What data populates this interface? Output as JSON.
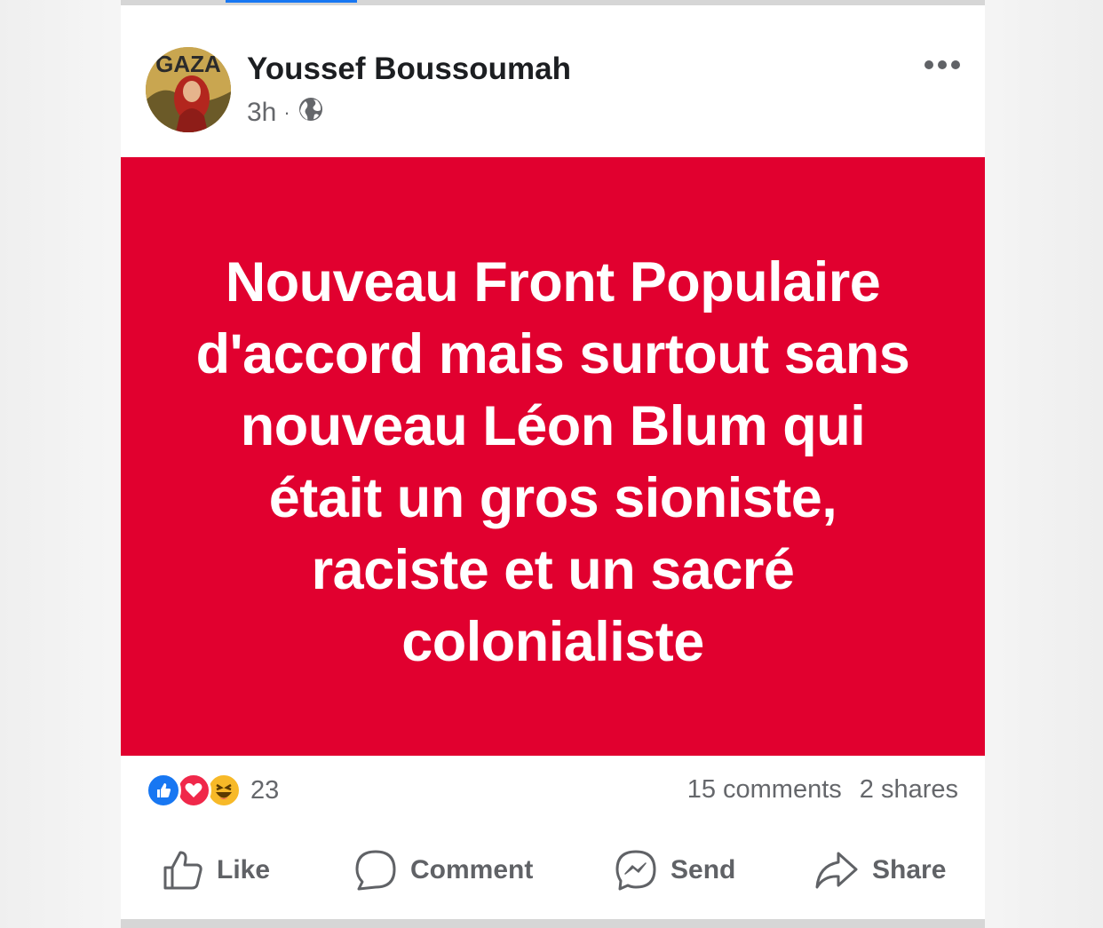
{
  "post": {
    "author": "Youssef Boussoumah",
    "time": "3h",
    "avatar_text": "GAZA",
    "text": "Nouveau Front Populaire\nd'accord mais surtout sans\nnouveau Léon Blum qui\nétait un gros sioniste,\nraciste et un sacré\ncolonialiste",
    "background_color": "#e1002f"
  },
  "stats": {
    "reaction_count": "23",
    "reactions": [
      "like-icon",
      "love-icon",
      "haha-icon"
    ],
    "comments": "15 comments",
    "shares": "2 shares"
  },
  "actions": {
    "like": "Like",
    "comment": "Comment",
    "send": "Send",
    "share": "Share"
  },
  "colors": {
    "accent": "#1877f2",
    "text_secondary": "#65676b"
  }
}
